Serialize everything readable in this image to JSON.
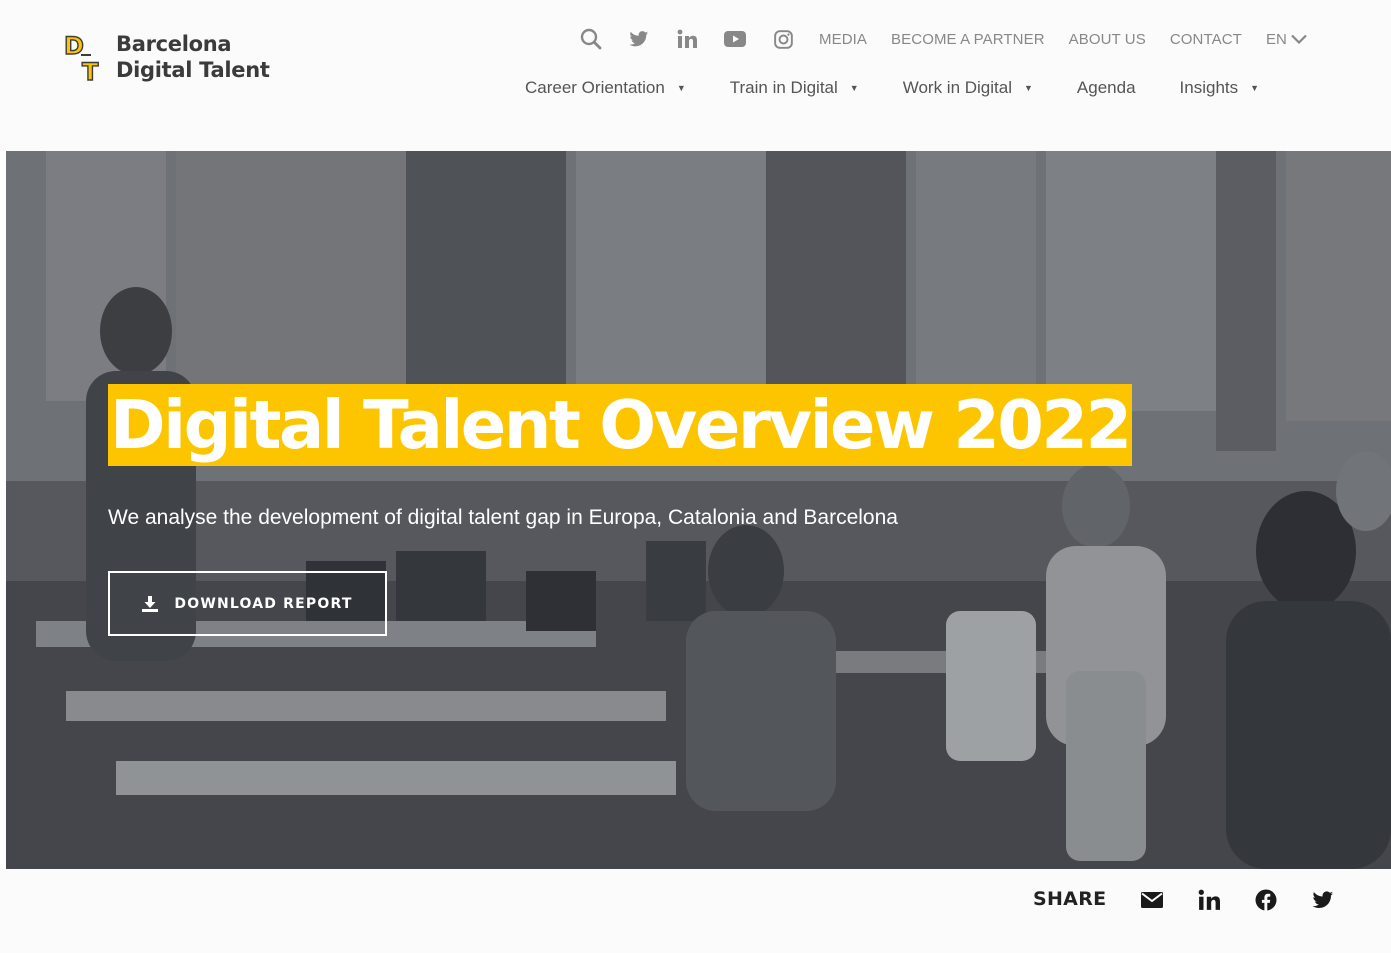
{
  "brand": {
    "name_line1": "Barcelona",
    "name_line2": "Digital Talent",
    "logo_mark": "DT",
    "accent_color": "#fcc500"
  },
  "top_nav": {
    "icons": [
      "search-icon",
      "twitter-icon",
      "linkedin-icon",
      "youtube-icon",
      "instagram-icon"
    ],
    "links": [
      "MEDIA",
      "BECOME A PARTNER",
      "ABOUT US",
      "CONTACT"
    ],
    "language": "EN"
  },
  "main_nav": {
    "items": [
      {
        "label": "Career Orientation",
        "has_dropdown": true
      },
      {
        "label": "Train in Digital",
        "has_dropdown": true
      },
      {
        "label": "Work in Digital",
        "has_dropdown": true
      },
      {
        "label": "Agenda",
        "has_dropdown": false
      },
      {
        "label": "Insights",
        "has_dropdown": true
      }
    ]
  },
  "hero": {
    "title": "Digital Talent Overview 2022",
    "subtitle": "We analyse the development of digital talent gap in Europa, Catalonia and Barcelona",
    "button_label": "DOWNLOAD REPORT",
    "button_icon": "download-icon",
    "background_image": "office-workspace-photo"
  },
  "share": {
    "label": "SHARE",
    "icons": [
      "email-icon",
      "linkedin-icon",
      "facebook-icon",
      "twitter-icon"
    ]
  }
}
